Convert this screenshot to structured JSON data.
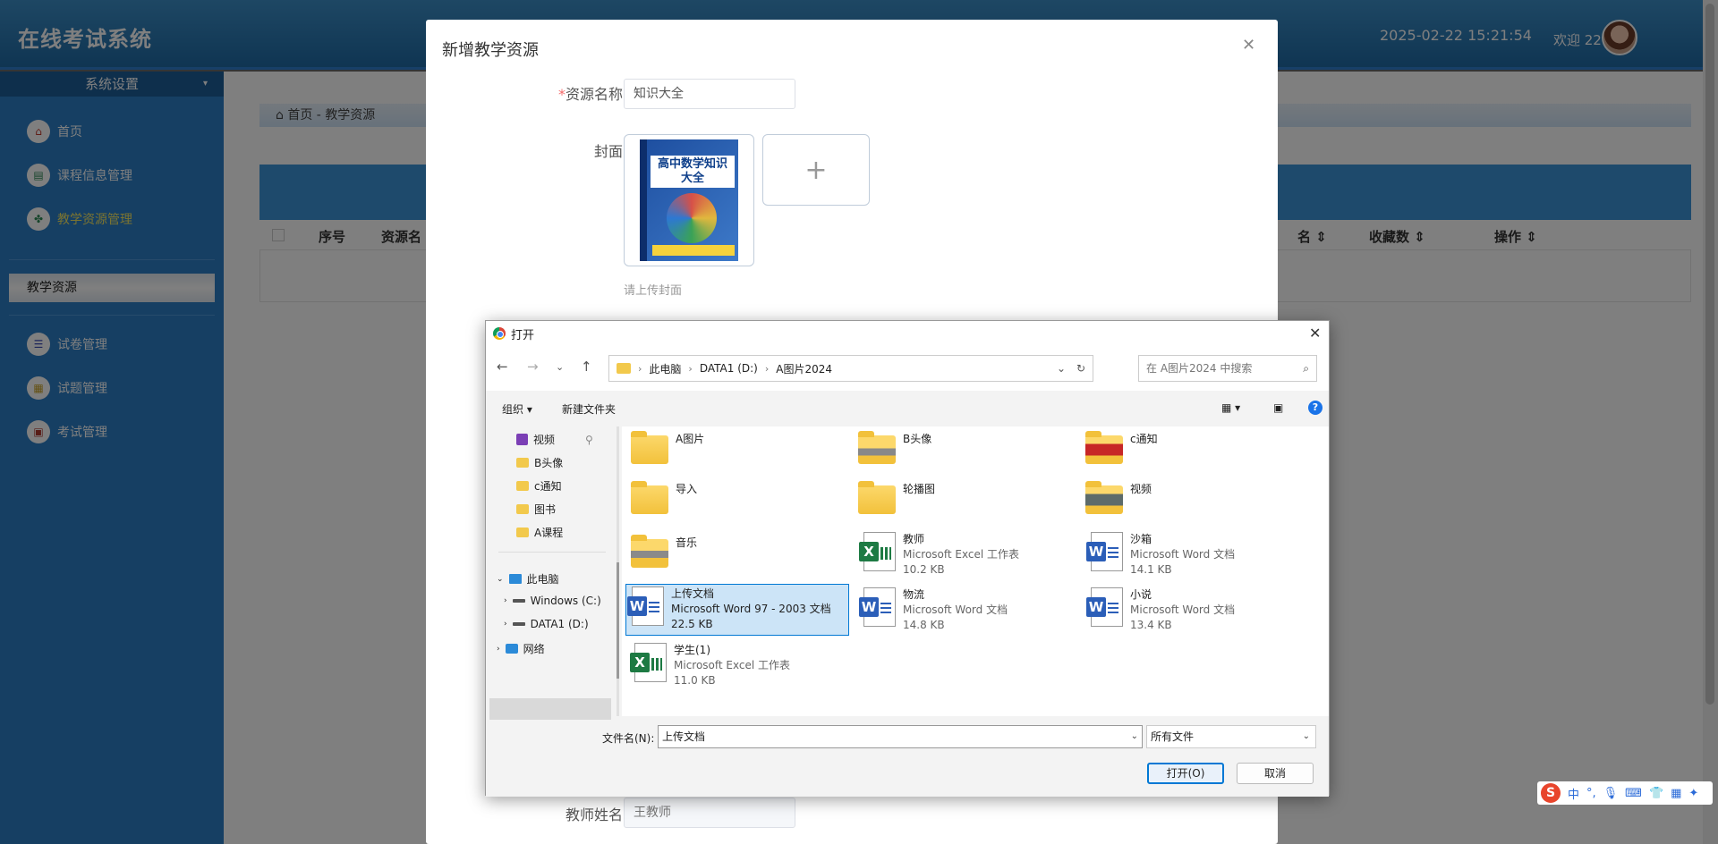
{
  "app": {
    "title": "在线考试系统",
    "datetime": "2025-02-22 15:21:54",
    "welcome": "欢迎 22"
  },
  "sidebar": {
    "header": "系统设置",
    "items": [
      {
        "label": "首页",
        "icon": "home-icon"
      },
      {
        "label": "课程信息管理",
        "icon": "course-icon"
      },
      {
        "label": "教学资源管理",
        "icon": "resource-icon"
      },
      {
        "label": "试卷管理",
        "icon": "paper-icon"
      },
      {
        "label": "试题管理",
        "icon": "question-icon"
      },
      {
        "label": "考试管理",
        "icon": "exam-icon"
      }
    ],
    "active_sub": "教学资源"
  },
  "main": {
    "breadcrumb": {
      "home": "首页",
      "sep": "-",
      "current": "教学资源"
    },
    "table_headers": [
      "序号",
      "资源名",
      "名",
      "收藏数",
      "操作"
    ]
  },
  "modal": {
    "title": "新增教学资源",
    "name_label": "资源名称",
    "name_required_mark": "*",
    "name_value": "知识大全",
    "cover_label": "封面",
    "cover_hint": "请上传封面",
    "cover_book": {
      "title": "高中数学知识大全"
    },
    "teacher_label": "教师姓名",
    "teacher_value": "王教师"
  },
  "open_dialog": {
    "title": "打开",
    "address": [
      "此电脑",
      "DATA1 (D:)",
      "A图片2024"
    ],
    "search_placeholder": "在 A图片2024 中搜索",
    "toolbar": {
      "organize": "组织 ▾",
      "new_folder": "新建文件夹"
    },
    "nav_pane": [
      {
        "label": "视频",
        "icon": "video-folder-icon"
      },
      {
        "label": "B头像",
        "icon": "folder-icon"
      },
      {
        "label": "c通知",
        "icon": "folder-icon"
      },
      {
        "label": "图书",
        "icon": "folder-icon"
      },
      {
        "label": "A课程",
        "icon": "folder-icon"
      },
      {
        "label": "此电脑",
        "icon": "pc-icon"
      },
      {
        "label": "Windows (C:)",
        "icon": "drive-icon"
      },
      {
        "label": "DATA1 (D:)",
        "icon": "drive-icon"
      },
      {
        "label": "网络",
        "icon": "network-icon"
      }
    ],
    "files": [
      {
        "name": "A图片",
        "kind": "folder"
      },
      {
        "name": "B头像",
        "kind": "folder-img"
      },
      {
        "name": "c通知",
        "kind": "folder-red"
      },
      {
        "name": "导入",
        "kind": "folder"
      },
      {
        "name": "轮播图",
        "kind": "folder"
      },
      {
        "name": "视频",
        "kind": "folder-dark"
      },
      {
        "name": "音乐",
        "kind": "folder-music"
      },
      {
        "name": "教师",
        "kind": "excel",
        "type": "Microsoft Excel 工作表",
        "size": "10.2 KB"
      },
      {
        "name": "沙箱",
        "kind": "word",
        "type": "Microsoft Word 文档",
        "size": "14.1 KB"
      },
      {
        "name": "上传文档",
        "kind": "word",
        "type": "Microsoft Word 97 - 2003 文档",
        "size": "22.5 KB"
      },
      {
        "name": "物流",
        "kind": "word",
        "type": "Microsoft Word 文档",
        "size": "14.8 KB"
      },
      {
        "name": "小说",
        "kind": "word",
        "type": "Microsoft Word 文档",
        "size": "13.4 KB"
      },
      {
        "name": "学生(1)",
        "kind": "excel",
        "type": "Microsoft Excel 工作表",
        "size": "11.0 KB"
      }
    ],
    "filename_label": "文件名(N):",
    "filename_value": "上传文档",
    "filetype_value": "所有文件",
    "open_button": "打开(O)",
    "cancel_button": "取消"
  },
  "ime": {
    "brand": "S",
    "mode": "中"
  }
}
